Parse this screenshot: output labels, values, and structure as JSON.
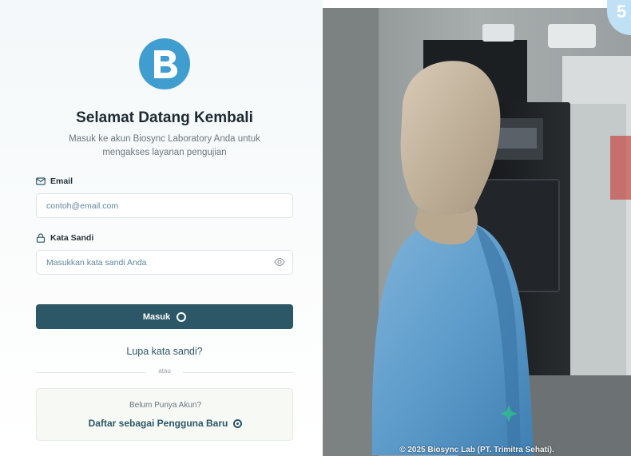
{
  "brand": {
    "logo_letter": "B",
    "logo_color": "#3f9ecf"
  },
  "header": {
    "title": "Selamat Datang Kembali",
    "subtitle": "Masuk ke akun Biosync Laboratory Anda untuk mengakses layanan pengujian"
  },
  "form": {
    "email_label": "Email",
    "email_icon": "mail-icon",
    "email_placeholder": "contoh@email.com",
    "password_label": "Kata Sandi",
    "password_icon": "lock-icon",
    "password_placeholder": "Masukkan kata sandi Anda",
    "toggle_icon": "eye-icon",
    "submit_label": "Masuk",
    "forgot_label": "Lupa kata sandi?",
    "divider_text": "atau"
  },
  "signup": {
    "question": "Belum Punya Akun?",
    "link_label": "Daftar sebagai Pengguna Baru"
  },
  "hero": {
    "copyright": "© 2025 Biosync Lab (PT. Trimitra Sehati)."
  },
  "corner_badge": {
    "text": "5"
  },
  "colors": {
    "primary": "#2b5766",
    "accent": "#3f9ecf"
  }
}
